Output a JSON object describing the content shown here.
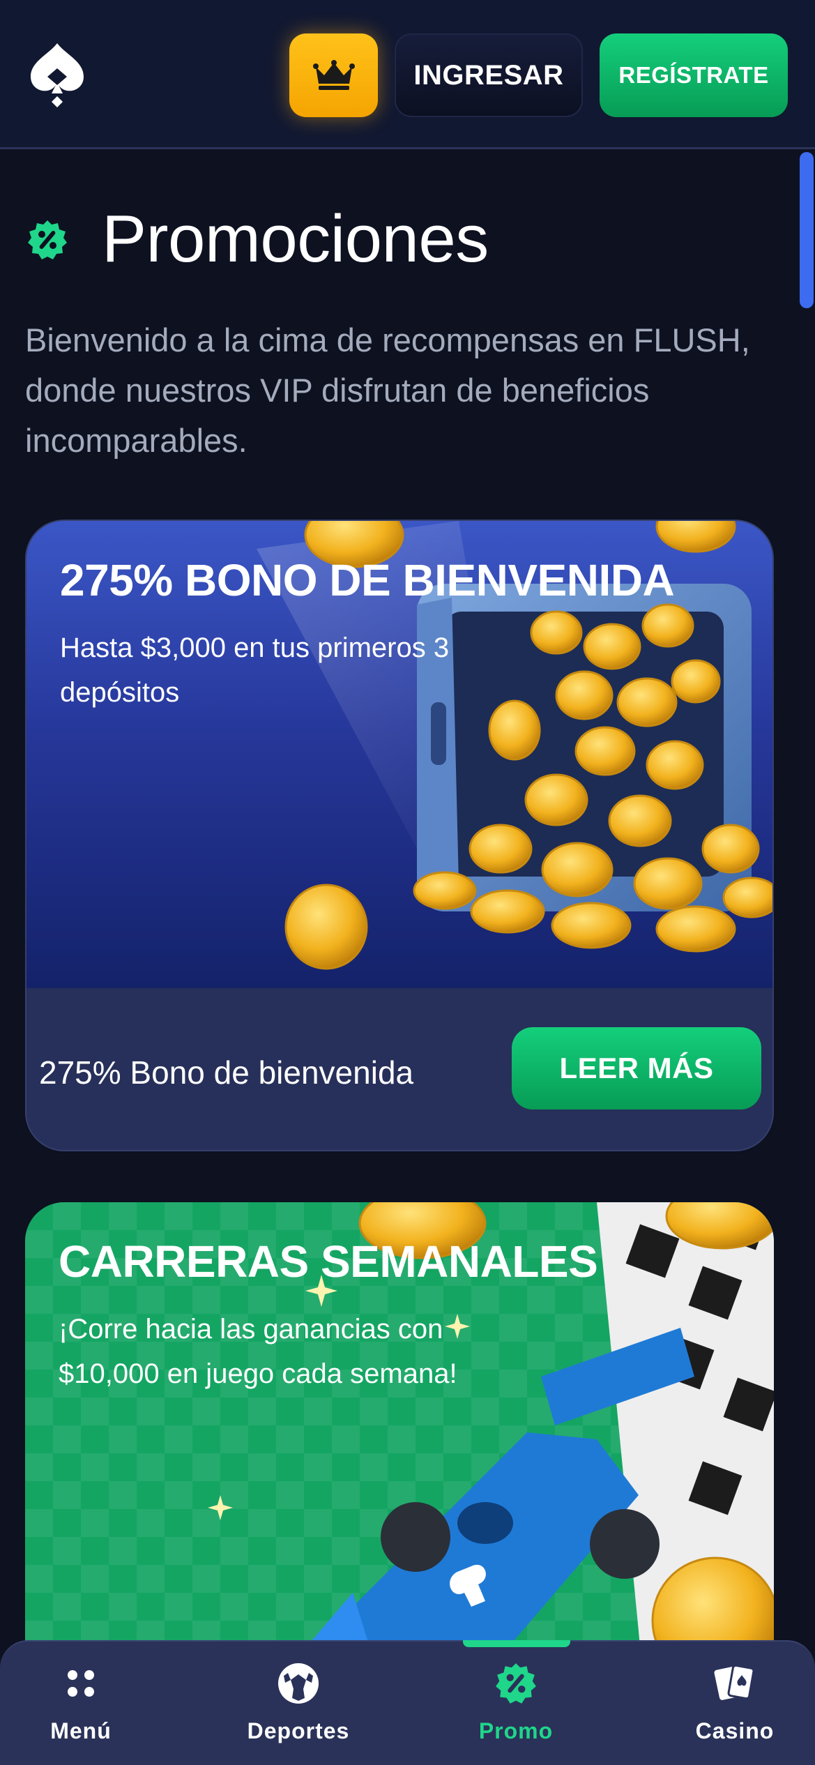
{
  "header": {
    "logo_icon": "spade-logo-icon",
    "vip_icon": "crown-icon",
    "login_label": "INGRESAR",
    "register_label": "REGÍSTRATE"
  },
  "page": {
    "title_icon": "percent-badge-icon",
    "title": "Promociones",
    "intro": "Bienvenido a la cima de recompensas en FLUSH, donde nuestros VIP disfrutan de beneficios incomparables."
  },
  "promos": [
    {
      "heading": "275% BONO DE BIENVENIDA",
      "subtitle": "Hasta $3,000 en tus primeros 3 depósitos",
      "footer_title": "275% Bono de bienvenida",
      "button_label": "LEER MÁS"
    },
    {
      "heading": "CARRERAS SEMANALES",
      "subtitle": "¡Corre hacia las ganancias con $10,000 en juego cada semana!"
    }
  ],
  "bottom_nav": [
    {
      "label": "Menú",
      "icon": "menu-dots-icon",
      "active": false
    },
    {
      "label": "Deportes",
      "icon": "soccer-ball-icon",
      "active": false
    },
    {
      "label": "Promo",
      "icon": "percent-badge-icon",
      "active": true
    },
    {
      "label": "Casino",
      "icon": "playing-cards-icon",
      "active": false
    }
  ],
  "colors": {
    "background": "#0d1120",
    "header": "#111831",
    "accent_green": "#1fd68a",
    "vip_gold": "#ffb81c",
    "nav_background": "#2a3259"
  }
}
